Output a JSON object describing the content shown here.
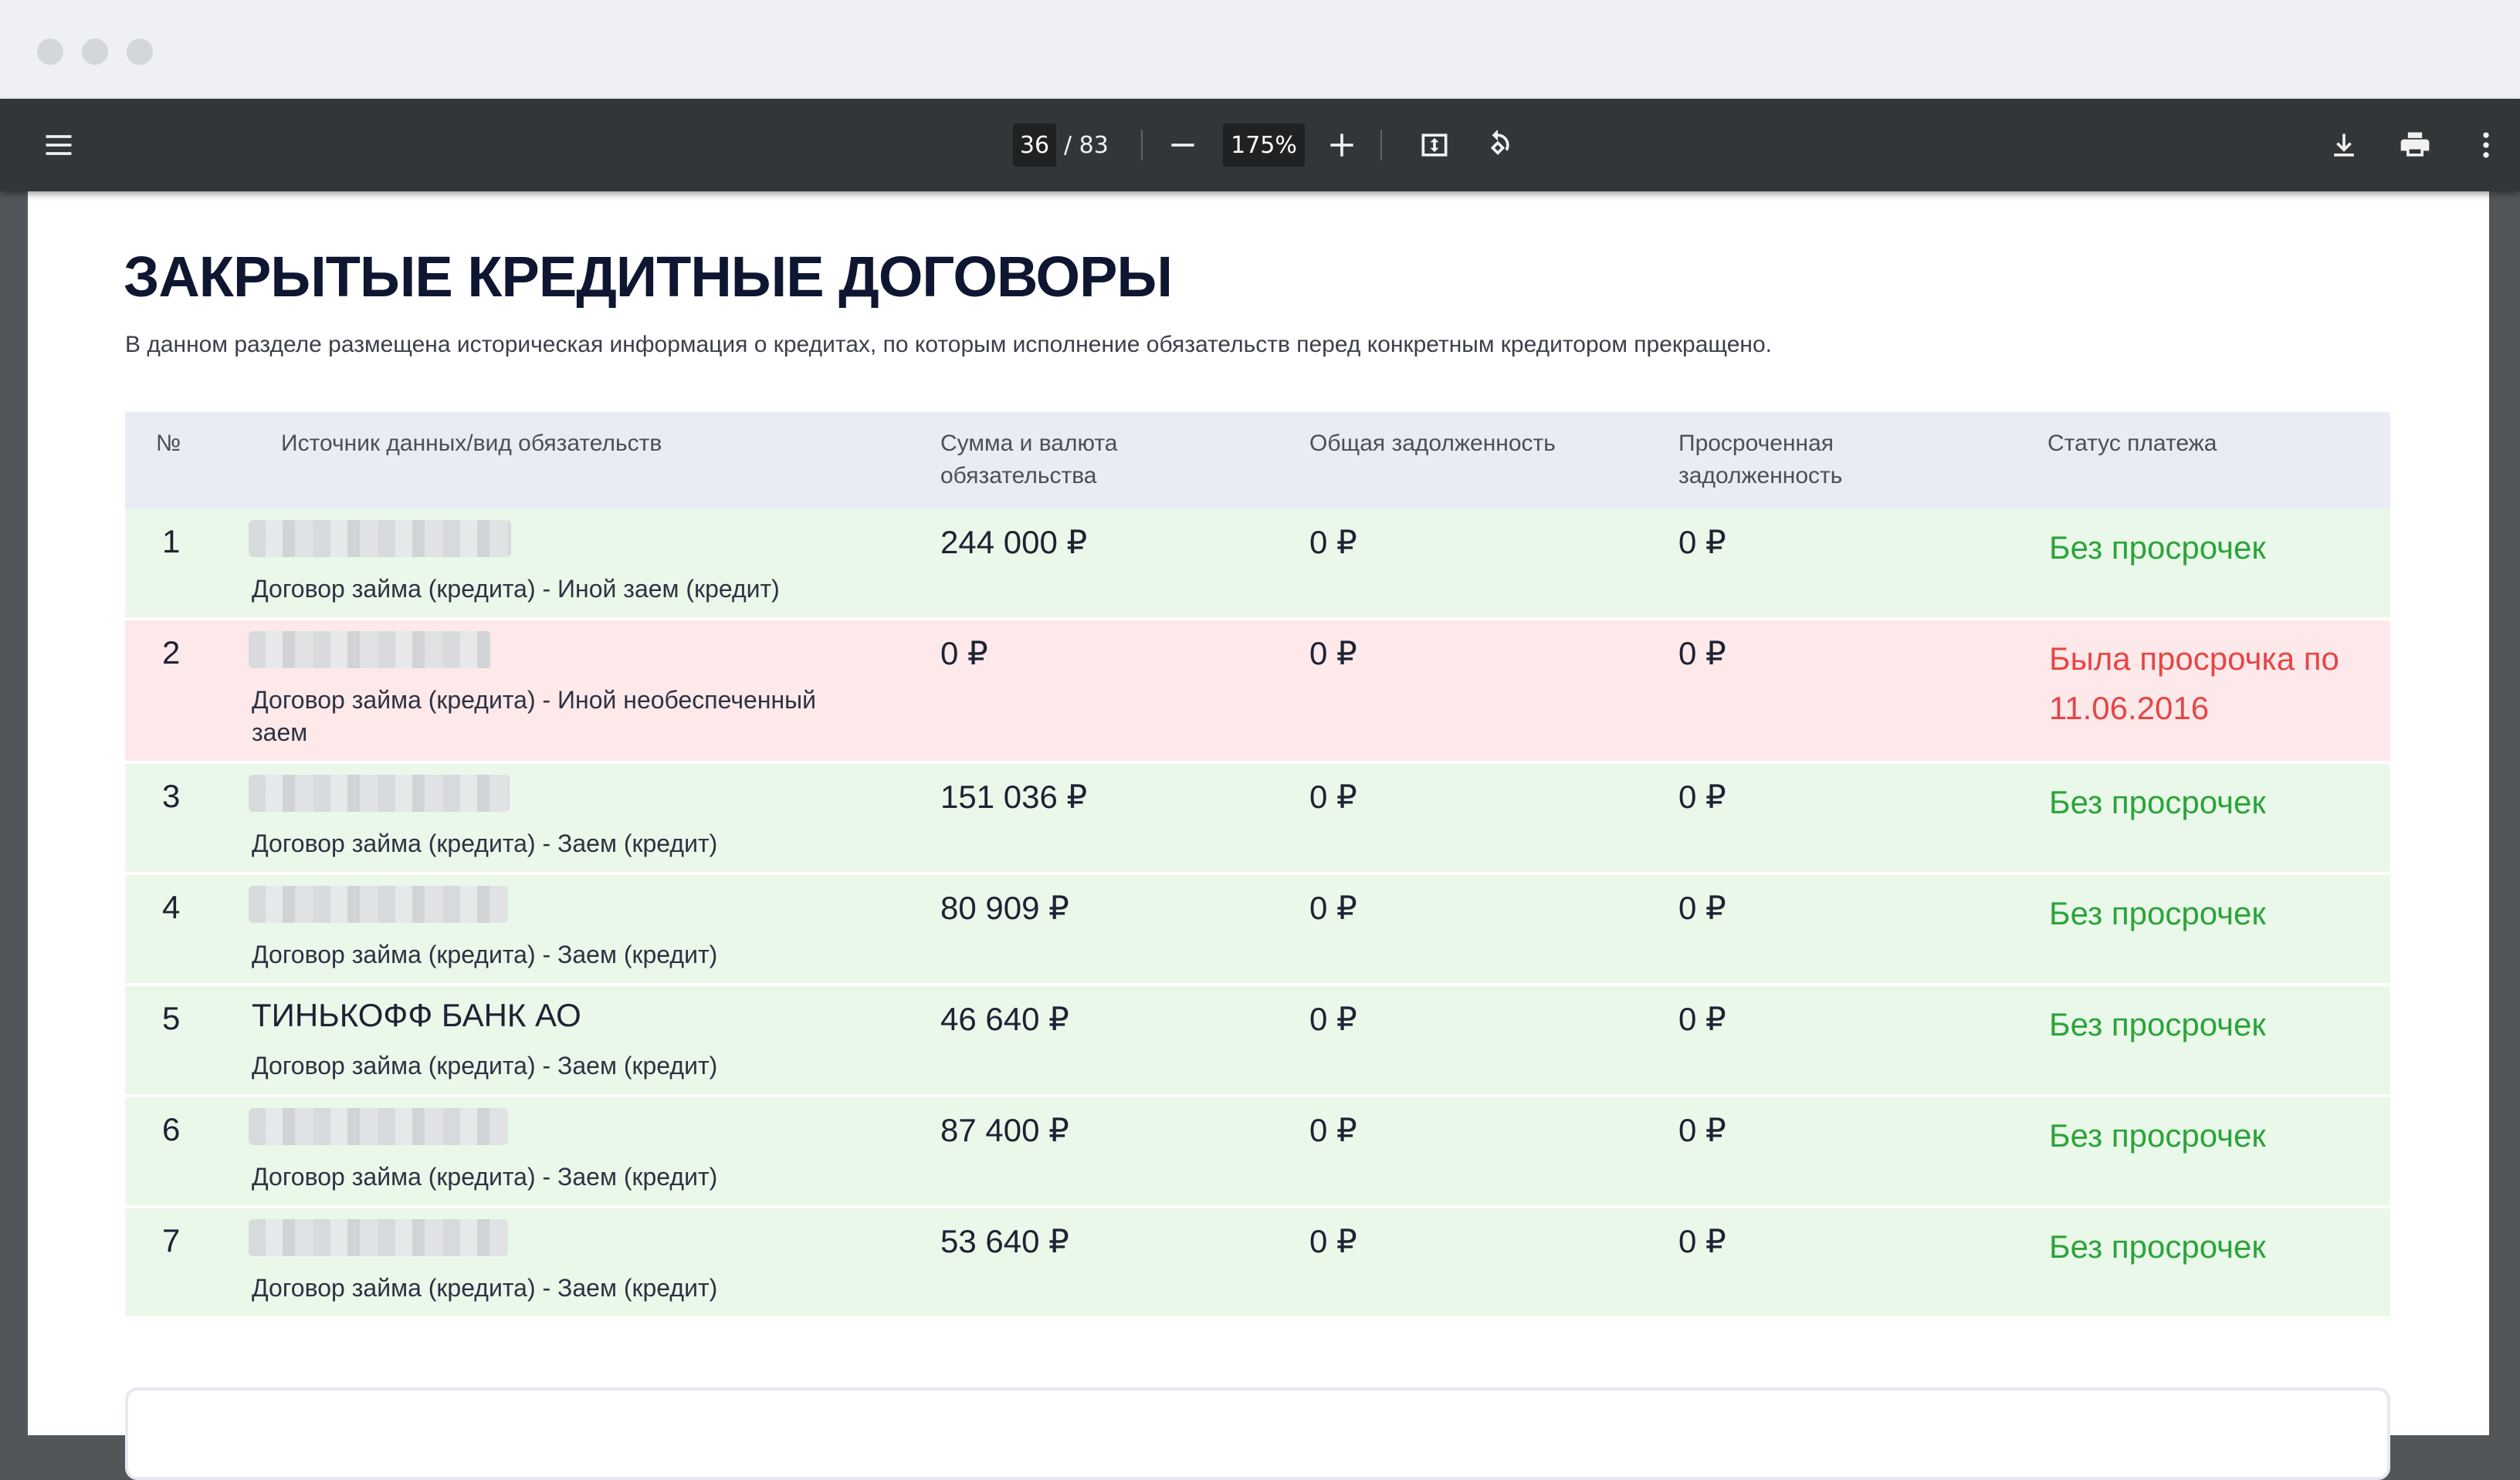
{
  "window": {
    "controls": [
      "close",
      "minimize",
      "maximize"
    ]
  },
  "toolbar": {
    "menu_icon": "hamburger-icon",
    "current_page": "36",
    "total_pages": "/ 83",
    "zoom": "175%",
    "zoom_out_icon": "minus-icon",
    "zoom_in_icon": "plus-icon",
    "fit_icon": "fit-page-icon",
    "rotate_icon": "rotate-icon",
    "download_icon": "download-icon",
    "print_icon": "print-icon",
    "more_icon": "more-vert-icon"
  },
  "document": {
    "title": "ЗАКРЫТЫЕ КРЕДИТНЫЕ ДОГОВОРЫ",
    "subtitle": "В данном разделе размещена историческая информация о кредитах, по которым исполнение обязательств перед конкретным кредитором прекращено.",
    "columns": [
      "№",
      "Источник данных/вид обязательств",
      "Сумма и валюта обязательства",
      "Общая задолженность",
      "Просроченная задолженность",
      "Статус платежа"
    ],
    "rows": [
      {
        "n": "1",
        "source": "",
        "type": "Договор займа (кредита) - Иной заем (кредит)",
        "amount": "244 000 ₽",
        "total": "0 ₽",
        "overdue": "0 ₽",
        "status": "Без просрочек",
        "state": "ok"
      },
      {
        "n": "2",
        "source": "",
        "type": "Договор займа (кредита) - Иной необеспеченный заем",
        "amount": "0 ₽",
        "total": "0 ₽",
        "overdue": "0 ₽",
        "status": "Была просрочка по 11.06.2016",
        "state": "bad"
      },
      {
        "n": "3",
        "source": "",
        "type": "Договор займа (кредита) - Заем (кредит)",
        "amount": "151 036 ₽",
        "total": "0 ₽",
        "overdue": "0 ₽",
        "status": "Без просрочек",
        "state": "ok"
      },
      {
        "n": "4",
        "source": "",
        "type": "Договор займа (кредита) - Заем (кредит)",
        "amount": "80 909 ₽",
        "total": "0 ₽",
        "overdue": "0 ₽",
        "status": "Без просрочек",
        "state": "ok"
      },
      {
        "n": "5",
        "source": "ТИНЬКОФФ БАНК АО",
        "type": "Договор займа (кредита) - Заем (кредит)",
        "amount": "46 640 ₽",
        "total": "0 ₽",
        "overdue": "0 ₽",
        "status": "Без просрочек",
        "state": "ok"
      },
      {
        "n": "6",
        "source": "",
        "type": "Договор займа (кредита) - Заем (кредит)",
        "amount": "87 400 ₽",
        "total": "0 ₽",
        "overdue": "0 ₽",
        "status": "Без просрочек",
        "state": "ok"
      },
      {
        "n": "7",
        "source": "",
        "type": "Договор займа (кредита) - Заем (кредит)",
        "amount": "53 640 ₽",
        "total": "0 ₽",
        "overdue": "0 ₽",
        "status": "Без просрочек",
        "state": "ok"
      }
    ]
  },
  "colors": {
    "ok_row": "#eaf8ea",
    "bad_row": "#fde9ea",
    "ok_text": "#2ba43a",
    "bad_text": "#e84545",
    "header_bg": "#e9ecf5"
  }
}
